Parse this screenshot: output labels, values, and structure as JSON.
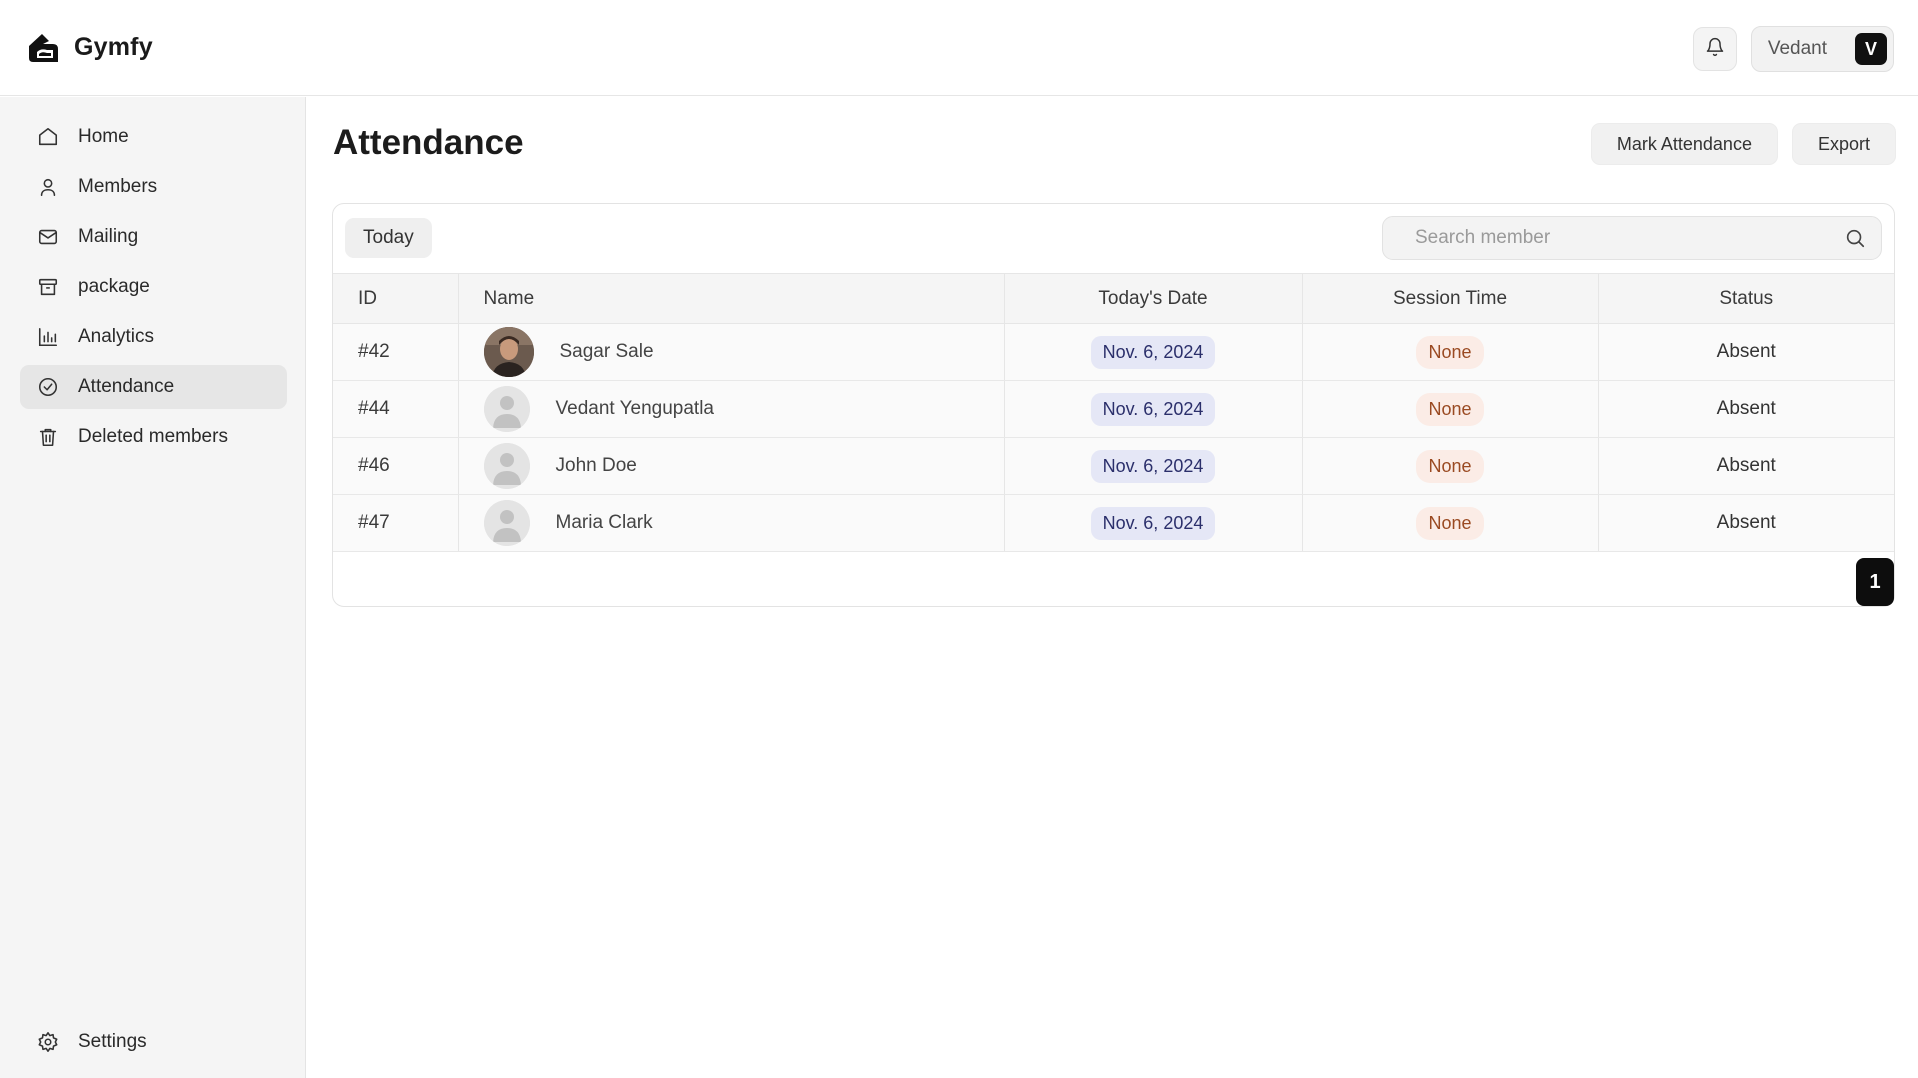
{
  "app": {
    "name": "Gymfy"
  },
  "header": {
    "user_name": "Vedant",
    "user_initial": "V"
  },
  "sidebar": {
    "items": [
      {
        "label": "Home",
        "icon": "home-icon",
        "active": false
      },
      {
        "label": "Members",
        "icon": "user-icon",
        "active": false
      },
      {
        "label": "Mailing",
        "icon": "mail-icon",
        "active": false
      },
      {
        "label": "package",
        "icon": "archive-icon",
        "active": false
      },
      {
        "label": "Analytics",
        "icon": "bar-chart-icon",
        "active": false
      },
      {
        "label": "Attendance",
        "icon": "check-circle-icon",
        "active": true
      },
      {
        "label": "Deleted members",
        "icon": "trash-icon",
        "active": false
      }
    ],
    "settings_label": "Settings"
  },
  "main": {
    "title": "Attendance",
    "mark_attendance_label": "Mark Attendance",
    "export_label": "Export",
    "filter_label": "Today",
    "search": {
      "placeholder": "Search member",
      "value": ""
    },
    "columns": [
      "ID",
      "Name",
      "Today's Date",
      "Session Time",
      "Status"
    ],
    "rows": [
      {
        "id": "#42",
        "name": "Sagar Sale",
        "date": "Nov. 6, 2024",
        "session": "None",
        "status": "Absent",
        "avatar": "photo"
      },
      {
        "id": "#44",
        "name": "Vedant Yengupatla",
        "date": "Nov. 6, 2024",
        "session": "None",
        "status": "Absent",
        "avatar": "placeholder"
      },
      {
        "id": "#46",
        "name": "John Doe",
        "date": "Nov. 6, 2024",
        "session": "None",
        "status": "Absent",
        "avatar": "placeholder"
      },
      {
        "id": "#47",
        "name": "Maria Clark",
        "date": "Nov. 6, 2024",
        "session": "None",
        "status": "Absent",
        "avatar": "placeholder"
      }
    ],
    "pagination": {
      "current_page": "1"
    }
  },
  "colors": {
    "date_pill_bg": "#e5e7f6",
    "date_pill_text": "#2b2f6b",
    "session_pill_bg": "#fbece6",
    "session_pill_text": "#9a4a22",
    "active_nav_bg": "#e6e6e6"
  }
}
